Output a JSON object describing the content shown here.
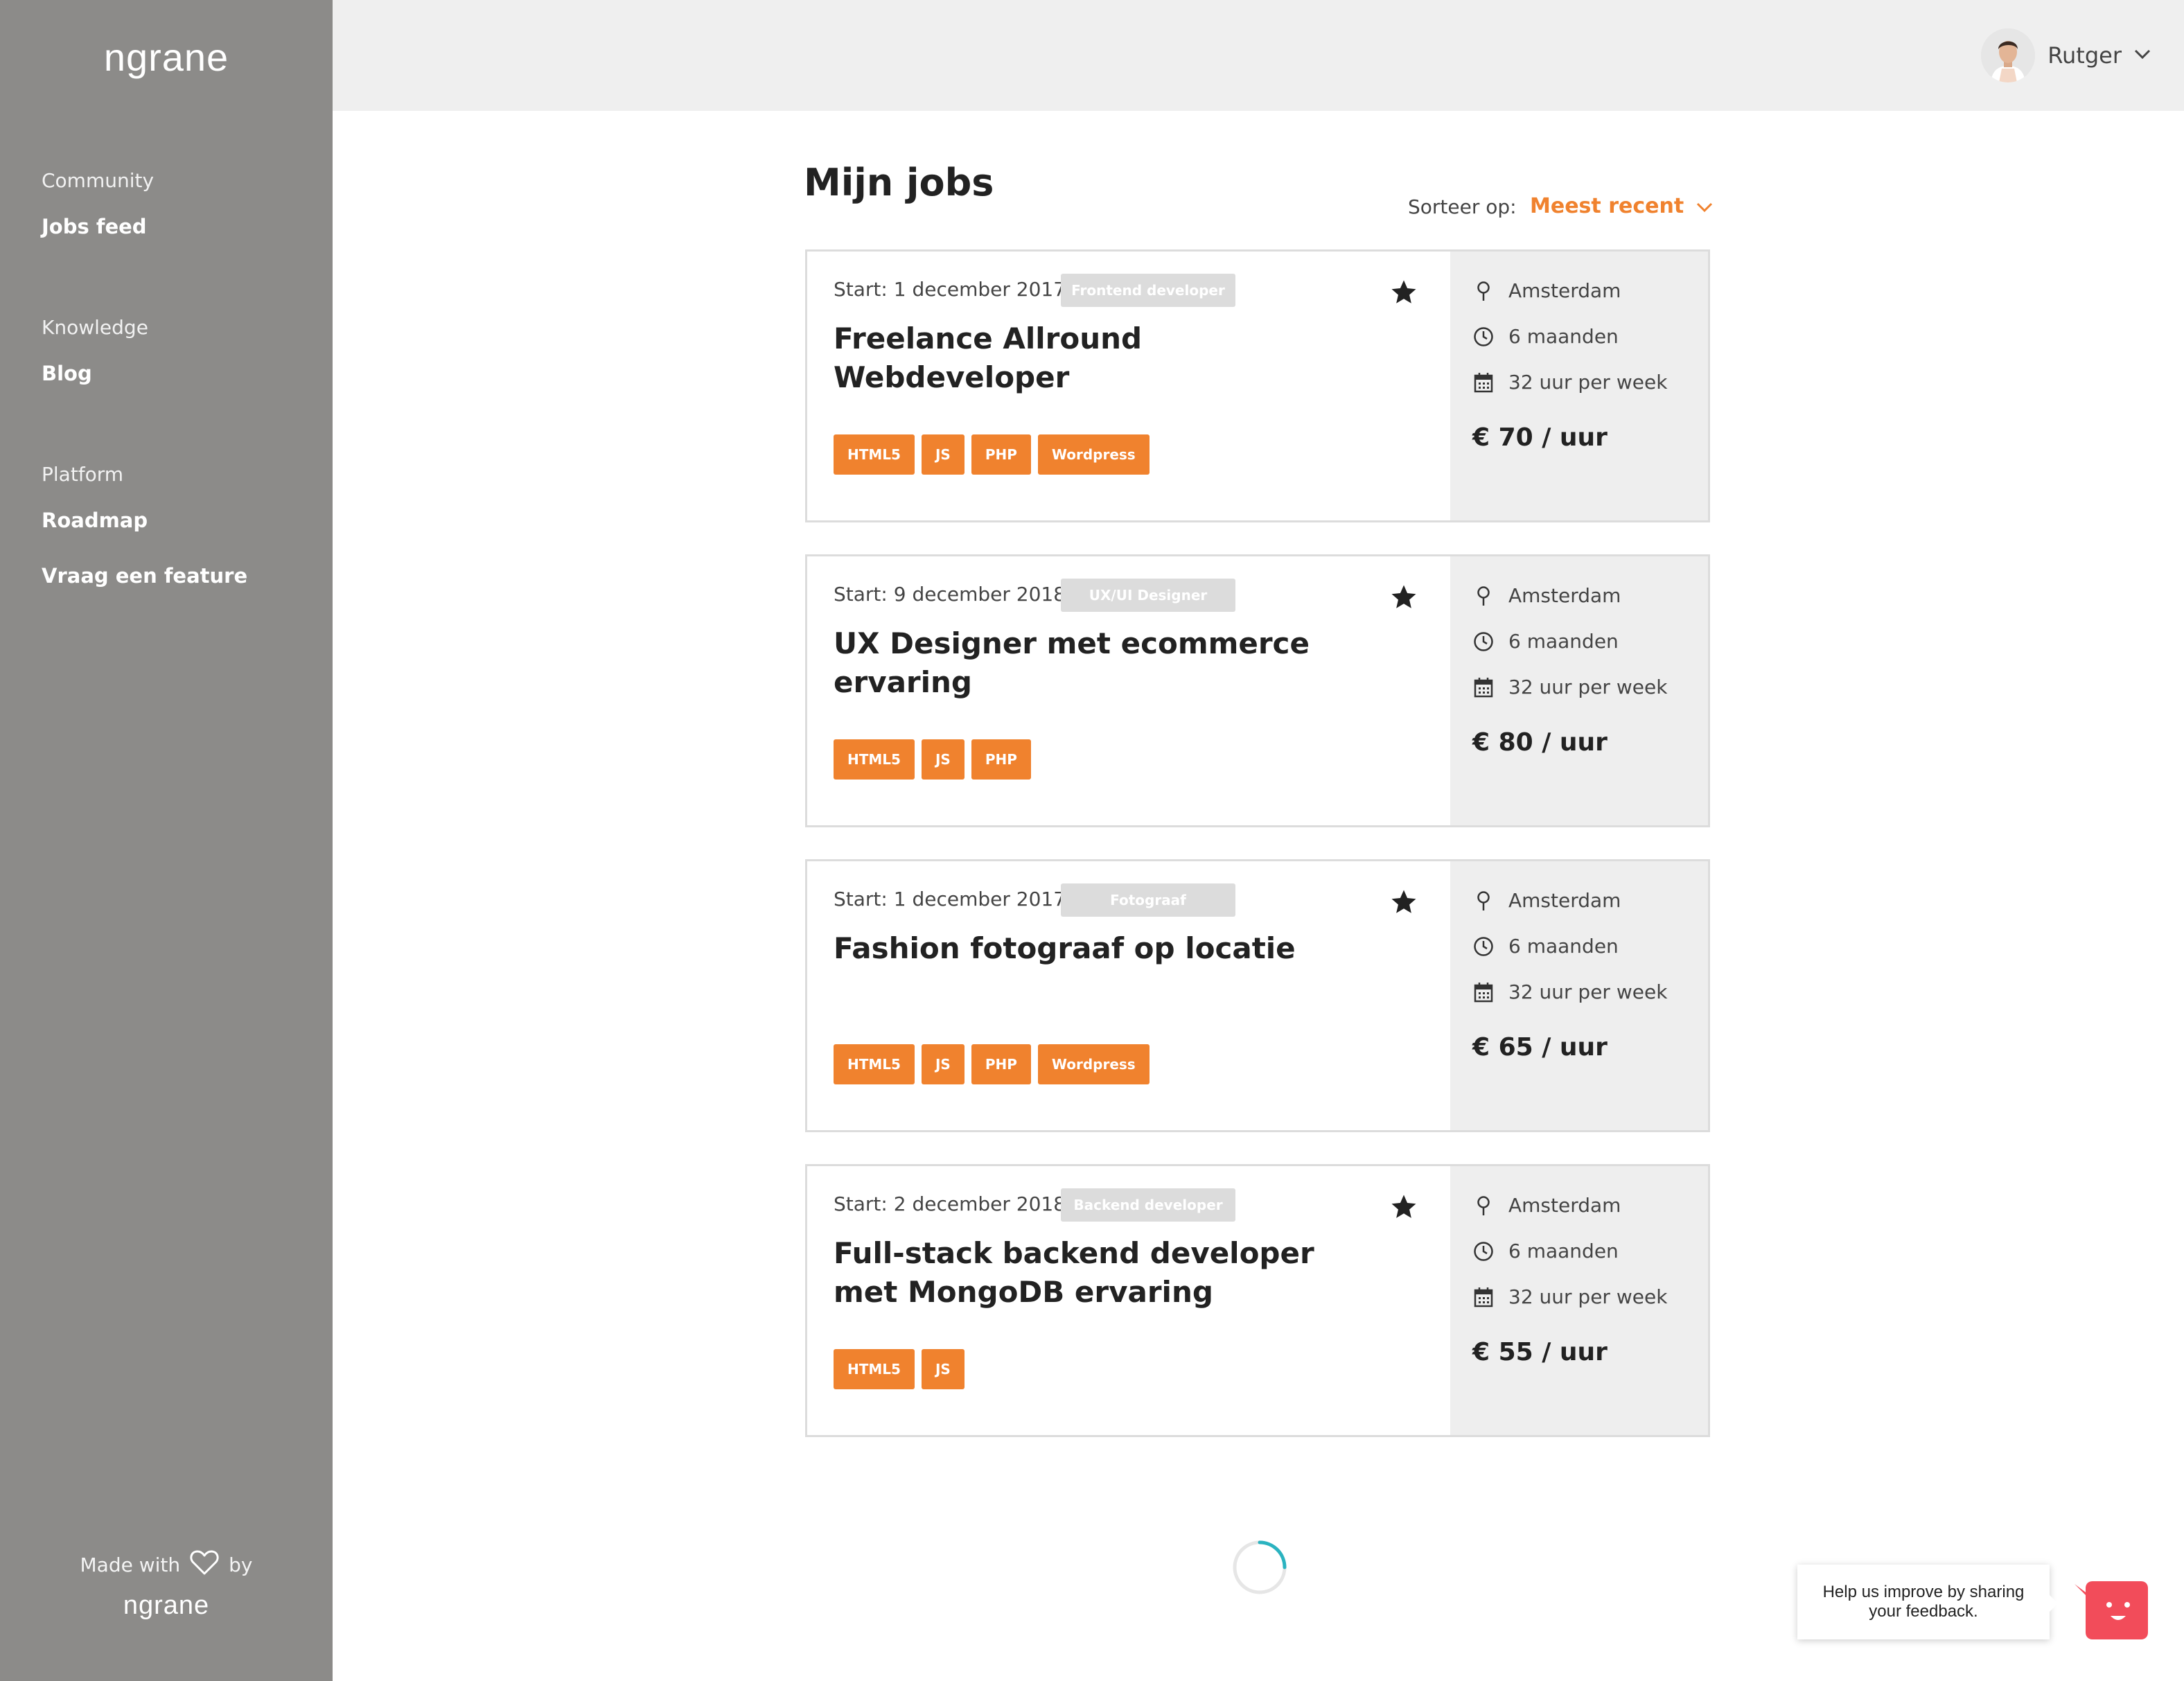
{
  "sidebar": {
    "logo": "ngrane",
    "sections": [
      {
        "heading": "Community",
        "items": [
          "Jobs feed"
        ]
      },
      {
        "heading": "Knowledge",
        "items": [
          "Blog"
        ]
      },
      {
        "heading": "Platform",
        "items": [
          "Roadmap",
          "Vraag een feature"
        ]
      }
    ],
    "footer": {
      "made_with": "Made with",
      "by": "by",
      "logo": "ngrane"
    }
  },
  "header": {
    "user_name": "Rutger"
  },
  "main": {
    "title": "Mijn jobs",
    "sort": {
      "label": "Sorteer op:",
      "value": "Meest recent"
    },
    "jobs": [
      {
        "start": "Start: 1 december 2017",
        "category": "Frontend developer",
        "title": "Freelance Allround Webdeveloper",
        "tags": [
          "HTML5",
          "JS",
          "PHP",
          "Wordpress"
        ],
        "location": "Amsterdam",
        "duration": "6 maanden",
        "hours": "32 uur per week",
        "rate": "€ 70 / uur"
      },
      {
        "start": "Start: 9 december 2018",
        "category": "UX/UI Designer",
        "title": "UX Designer met ecommerce ervaring",
        "tags": [
          "HTML5",
          "JS",
          "PHP"
        ],
        "location": "Amsterdam",
        "duration": "6 maanden",
        "hours": "32 uur per week",
        "rate": "€ 80 / uur"
      },
      {
        "start": "Start: 1 december 2017",
        "category": "Fotograaf",
        "title": "Fashion fotograaf op locatie",
        "tags": [
          "HTML5",
          "JS",
          "PHP",
          "Wordpress"
        ],
        "location": "Amsterdam",
        "duration": "6 maanden",
        "hours": "32 uur per week",
        "rate": "€ 65 / uur"
      },
      {
        "start": "Start: 2 december 2018",
        "category": "Backend developer",
        "title": "Full-stack backend developer met MongoDB ervaring",
        "tags": [
          "HTML5",
          "JS"
        ],
        "location": "Amsterdam",
        "duration": "6 maanden",
        "hours": "32 uur per week",
        "rate": "€ 55 / uur"
      }
    ]
  },
  "feedback": {
    "text": "Help us improve by sharing your feedback."
  },
  "colors": {
    "accent": "#f0822e",
    "sidebar": "#8c8b89",
    "feedback": "#f24c5a",
    "spinner": "#2bb3c0"
  }
}
